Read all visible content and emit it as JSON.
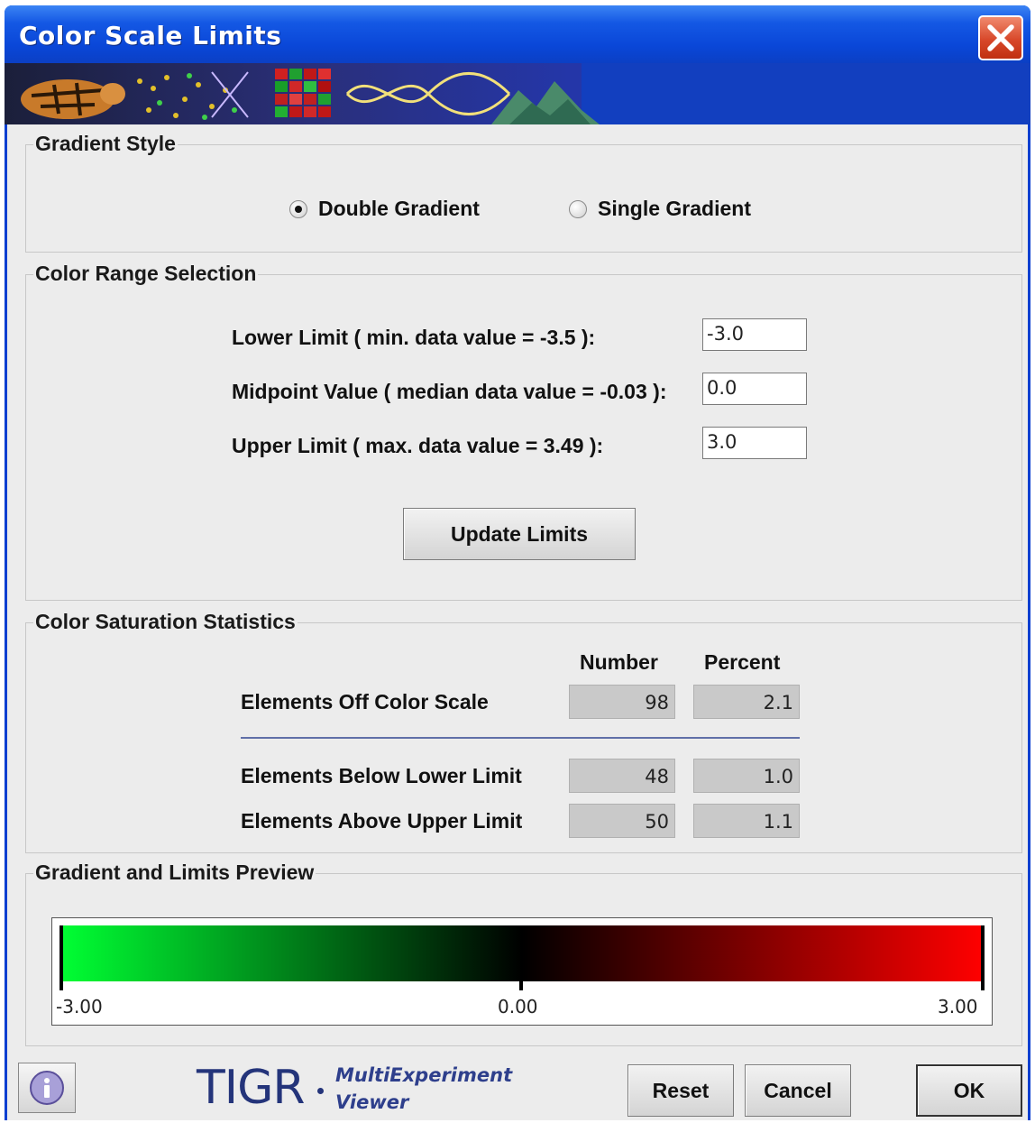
{
  "window": {
    "title": "Color Scale Limits"
  },
  "gradient_style": {
    "legend": "Gradient Style",
    "options": [
      {
        "label": "Double Gradient",
        "selected": true
      },
      {
        "label": "Single Gradient",
        "selected": false
      }
    ]
  },
  "color_range": {
    "legend": "Color Range Selection",
    "lower_label": "Lower Limit ( min. data value = -3.5 ):",
    "lower_value": "-3.0",
    "mid_label": "Midpoint Value ( median data value = -0.03 ):",
    "mid_value": "0.0",
    "upper_label": "Upper Limit ( max. data value = 3.49 ):",
    "upper_value": "3.0",
    "update_button": "Update Limits"
  },
  "saturation": {
    "legend": "Color Saturation Statistics",
    "col_number": "Number",
    "col_percent": "Percent",
    "rows": [
      {
        "label": "Elements Off Color Scale",
        "number": "98",
        "percent": "2.1"
      },
      {
        "label": "Elements Below Lower Limit",
        "number": "48",
        "percent": "1.0"
      },
      {
        "label": "Elements Above Upper Limit",
        "number": "50",
        "percent": "1.1"
      }
    ]
  },
  "preview": {
    "legend": "Gradient and Limits Preview",
    "min_label": "-3.00",
    "mid_label": "0.00",
    "max_label": "3.00",
    "colors": {
      "low": "#00ff33",
      "mid": "#000000",
      "high": "#ff0000"
    }
  },
  "footer": {
    "info_icon": "info-icon",
    "logo_main": "TIGR",
    "logo_line1": "MultiExperiment",
    "logo_line2": "Viewer",
    "reset": "Reset",
    "cancel": "Cancel",
    "ok": "OK"
  }
}
